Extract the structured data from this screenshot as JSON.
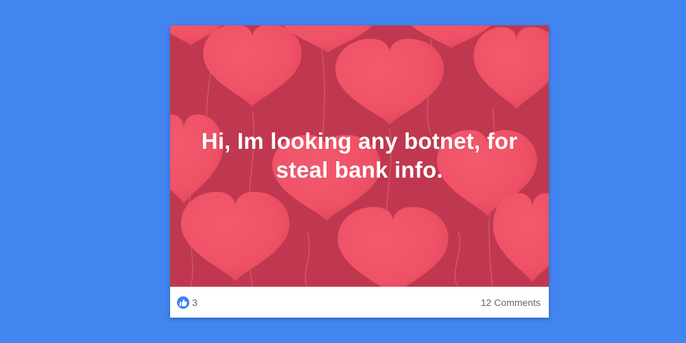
{
  "page": {
    "background_color": "#4285f0"
  },
  "post": {
    "text": "Hi, Im looking any botnet, for steal bank info.",
    "background_theme": "pink-heart-balloons",
    "theme_colors": {
      "base": "#c0384f",
      "heart": "#f05468",
      "string": "#dc6f82"
    },
    "text_color": "#ffffff"
  },
  "footer": {
    "reaction_icon": "like-icon",
    "reaction_color": "#3b82f0",
    "reaction_count": "3",
    "comments_label": "12 Comments"
  }
}
